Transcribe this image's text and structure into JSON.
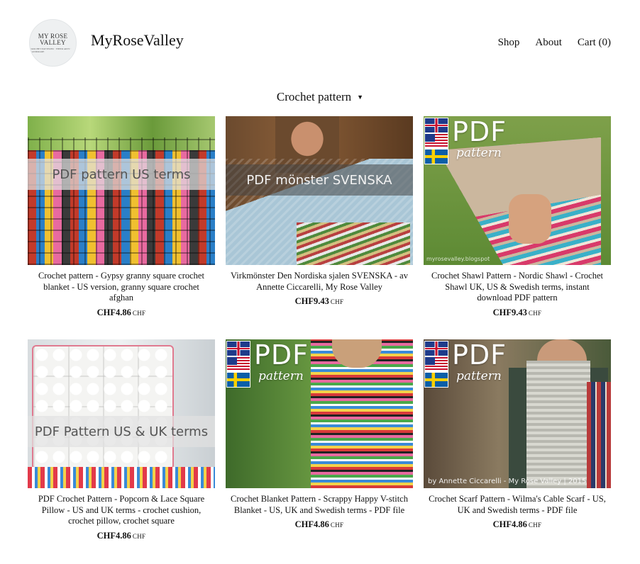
{
  "header": {
    "logo_line1": "MY ROSE",
    "logo_line2": "VALLEY",
    "logo_tagline": "CROCHET PATTERNS · FIBER ARTS · HANDMADE",
    "store_name": "MyRoseValley",
    "nav": {
      "shop": "Shop",
      "about": "About",
      "cart": "Cart (0)"
    }
  },
  "category": {
    "label": "Crochet pattern",
    "caret": "▼"
  },
  "colors": {
    "text": "#111111",
    "background": "#ffffff"
  },
  "products": [
    {
      "title": "Crochet pattern - Gypsy granny square crochet blanket - US version, granny square crochet afghan",
      "price": "CHF4.86",
      "currency": "CHF",
      "overlay": "PDF pattern US terms"
    },
    {
      "title": "Virkmönster Den Nordiska sjalen SVENSKA - av Annette Ciccarelli, My Rose Valley",
      "price": "CHF9.43",
      "currency": "CHF",
      "overlay": "PDF mönster SVENSKA"
    },
    {
      "title": "Crochet Shawl Pattern - Nordic Shawl - Crochet Shawl UK, US & Swedish terms, instant download PDF pattern",
      "price": "CHF9.43",
      "currency": "CHF",
      "overlay_pdf": "PDF",
      "overlay_pattern": "pattern",
      "watermark": "myrosevalley.blogspot"
    },
    {
      "title": "PDF Crochet Pattern - Popcorn & Lace Square Pillow - US and UK terms - crochet cushion, crochet pillow, crochet square",
      "price": "CHF4.86",
      "currency": "CHF",
      "overlay": "PDF Pattern US & UK terms"
    },
    {
      "title": "Crochet Blanket Pattern - Scrappy Happy V-stitch Blanket - US, UK and Swedish terms - PDF file",
      "price": "CHF4.86",
      "currency": "CHF",
      "overlay_pdf": "PDF",
      "overlay_pattern": "pattern"
    },
    {
      "title": "Crochet Scarf Pattern - Wilma's Cable Scarf - US, UK and Swedish terms - PDF file",
      "price": "CHF4.86",
      "currency": "CHF",
      "overlay_pdf": "PDF",
      "overlay_pattern": "pattern",
      "watermark": "by Annette Ciccarelli - My Rose Valley | 2015"
    }
  ]
}
